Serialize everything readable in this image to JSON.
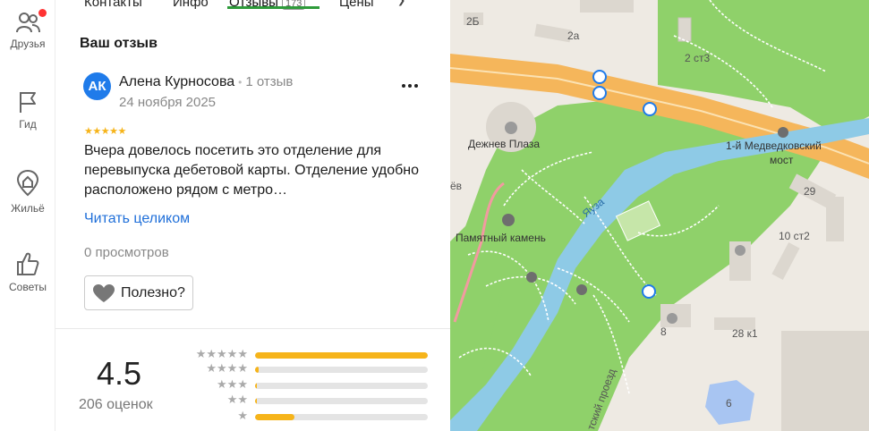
{
  "rail": {
    "items": [
      {
        "label": "Друзья",
        "icon": "friends-icon"
      },
      {
        "label": "Гид",
        "icon": "flag-icon"
      },
      {
        "label": "Жильё",
        "icon": "housing-icon"
      },
      {
        "label": "Советы",
        "icon": "thumbs-up-icon"
      }
    ]
  },
  "tabs": {
    "items": [
      "Контакты",
      "Инфо",
      "Отзывы",
      "Цены"
    ],
    "reviews_badge": "173",
    "active": "Отзывы"
  },
  "review": {
    "section_title": "Ваш отзыв",
    "avatar_initials": "АК",
    "author": "Алена Курносова",
    "separator": "•",
    "author_reviews": "1 отзыв",
    "date": "24 ноября 2025",
    "stars": "★★★★★",
    "text": "Вчера довелось посетить это отделение для перевыпуска дебетовой карты. Отделение удобно расположено рядом с метро…",
    "read_more": "Читать целиком",
    "views": "0 просмотров",
    "useful_label": "Полезно?"
  },
  "rating": {
    "value": "4.5",
    "count": "206 оценок",
    "distribution": [
      {
        "stars": "★★★★★",
        "fraction": 1.0
      },
      {
        "stars": "★★★★",
        "fraction": 0.02
      },
      {
        "stars": "★★★",
        "fraction": 0.01
      },
      {
        "stars": "★★",
        "fraction": 0.01
      },
      {
        "stars": "★",
        "fraction": 0.23
      }
    ]
  },
  "map": {
    "labels": {
      "b2": "2Б",
      "a2": "2а",
      "st3": "2 ст3",
      "plaza": "Дежнев Плаза",
      "bridge1": "1-й Медведковский",
      "bridge2": "мост",
      "yo": "ёв",
      "yauza": "Яуза",
      "stone": "Памятный камень",
      "n29": "29",
      "st2": "10 ст2",
      "n8": "8",
      "k1": "28 к1",
      "n6": "6",
      "proezd": "тский проезд"
    }
  },
  "colors": {
    "accent": "#2e9b3a",
    "link": "#1f6fd9",
    "star": "#f6b41a",
    "avatar": "#1f7bea",
    "park": "#8fd16a",
    "river": "#8ecae6",
    "highway": "#f5b65b"
  }
}
